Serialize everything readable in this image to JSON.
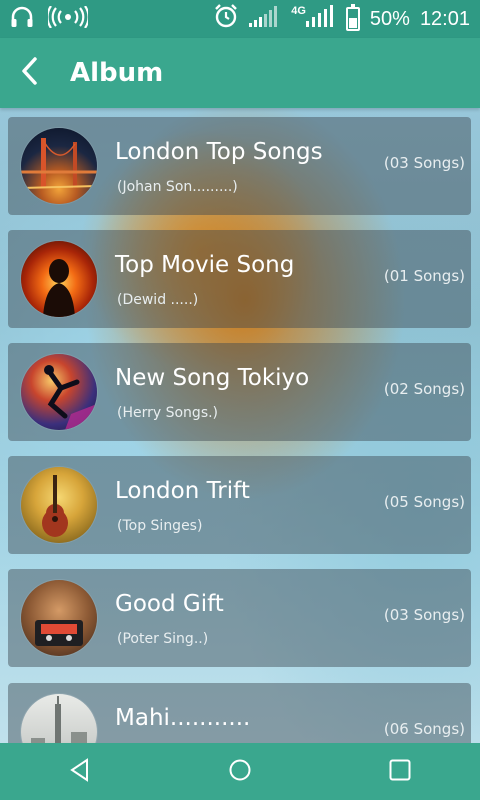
{
  "status_bar": {
    "battery_percent": "50%",
    "time": "12:01",
    "network": "4G",
    "icons": [
      "headphones-icon",
      "wifi-hotspot-icon",
      "alarm-icon",
      "signal-icon",
      "signal-4g-icon",
      "battery-icon"
    ]
  },
  "app_bar": {
    "title": "Album",
    "back_icon": "chevron-left-icon"
  },
  "albums": [
    {
      "title": "London Top Songs",
      "artist": "(Johan Son.........)",
      "count": "(03 Songs)",
      "art": "bridge-night"
    },
    {
      "title": "Top Movie Song",
      "artist": "(Dewid .....)",
      "count": "(01 Songs)",
      "art": "fire-figure"
    },
    {
      "title": "New Song Tokiyo",
      "artist": "(Herry Songs.)",
      "count": "(02 Songs)",
      "art": "dancer"
    },
    {
      "title": "London Trift",
      "artist": "(Top Singes)",
      "count": "(05 Songs)",
      "art": "guitar"
    },
    {
      "title": "Good Gift",
      "artist": "(Poter Sing..)",
      "count": "(03 Songs)",
      "art": "cassette"
    },
    {
      "title": "Mahi...........",
      "artist": "",
      "count": "(06 Songs)",
      "art": "city-skyline"
    }
  ],
  "nav_bar": {
    "icons": [
      "back-triangle-icon",
      "home-circle-icon",
      "recents-square-icon"
    ]
  },
  "colors": {
    "status_bar": "#2f9a84",
    "app_bar": "#3aa78e",
    "card_bg": "rgba(60,70,80,0.45)",
    "text": "#ffffff"
  }
}
